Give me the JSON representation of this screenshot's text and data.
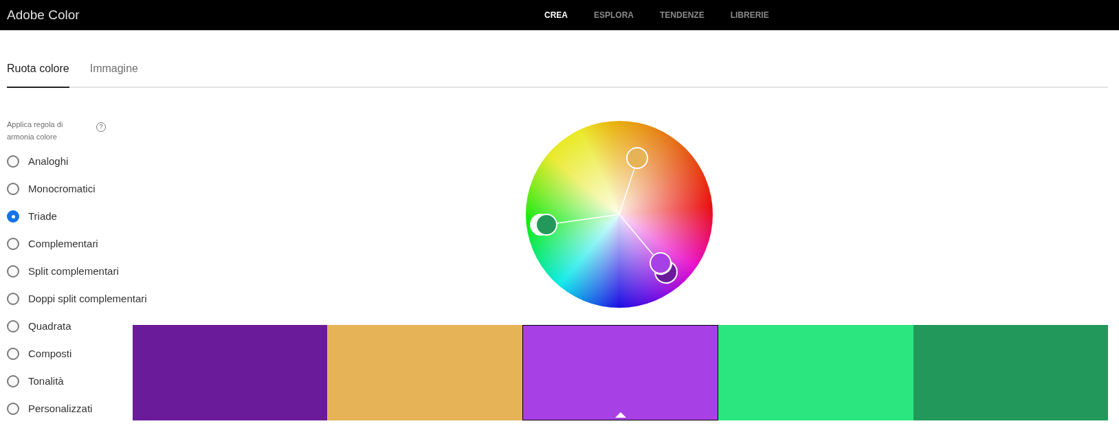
{
  "header": {
    "title": "Adobe Color",
    "nav": [
      {
        "label": "CREA",
        "selected": true
      },
      {
        "label": "ESPLORA",
        "selected": false
      },
      {
        "label": "TENDENZE",
        "selected": false
      },
      {
        "label": "LIBRERIE",
        "selected": false
      }
    ]
  },
  "tabs": [
    {
      "label": "Ruota colore",
      "selected": true
    },
    {
      "label": "Immagine",
      "selected": false
    }
  ],
  "harmony": {
    "label": "Applica regola di armonia colore",
    "help": "?",
    "options": [
      {
        "label": "Analoghi",
        "selected": false
      },
      {
        "label": "Monocromatici",
        "selected": false
      },
      {
        "label": "Triade",
        "selected": true
      },
      {
        "label": "Complementari",
        "selected": false
      },
      {
        "label": "Split complementari",
        "selected": false
      },
      {
        "label": "Doppi split complementari",
        "selected": false
      },
      {
        "label": "Quadrata",
        "selected": false
      },
      {
        "label": "Composti",
        "selected": false
      },
      {
        "label": "Tonalità",
        "selected": false
      },
      {
        "label": "Personalizzati",
        "selected": false
      }
    ]
  },
  "wheel": {
    "handles": [
      {
        "color": "#6a1b9a",
        "kind": "behind"
      },
      {
        "color": "#e6b357",
        "kind": "front"
      },
      {
        "color": "#a841e5",
        "kind": "front"
      },
      {
        "color": "#22995a",
        "kind": "front"
      }
    ]
  },
  "swatches": [
    {
      "color": "#6a1b9a",
      "selected": false
    },
    {
      "color": "#e6b357",
      "selected": false
    },
    {
      "color": "#a841e5",
      "selected": true
    },
    {
      "color": "#2be67f",
      "selected": false
    },
    {
      "color": "#22995a",
      "selected": false
    }
  ]
}
